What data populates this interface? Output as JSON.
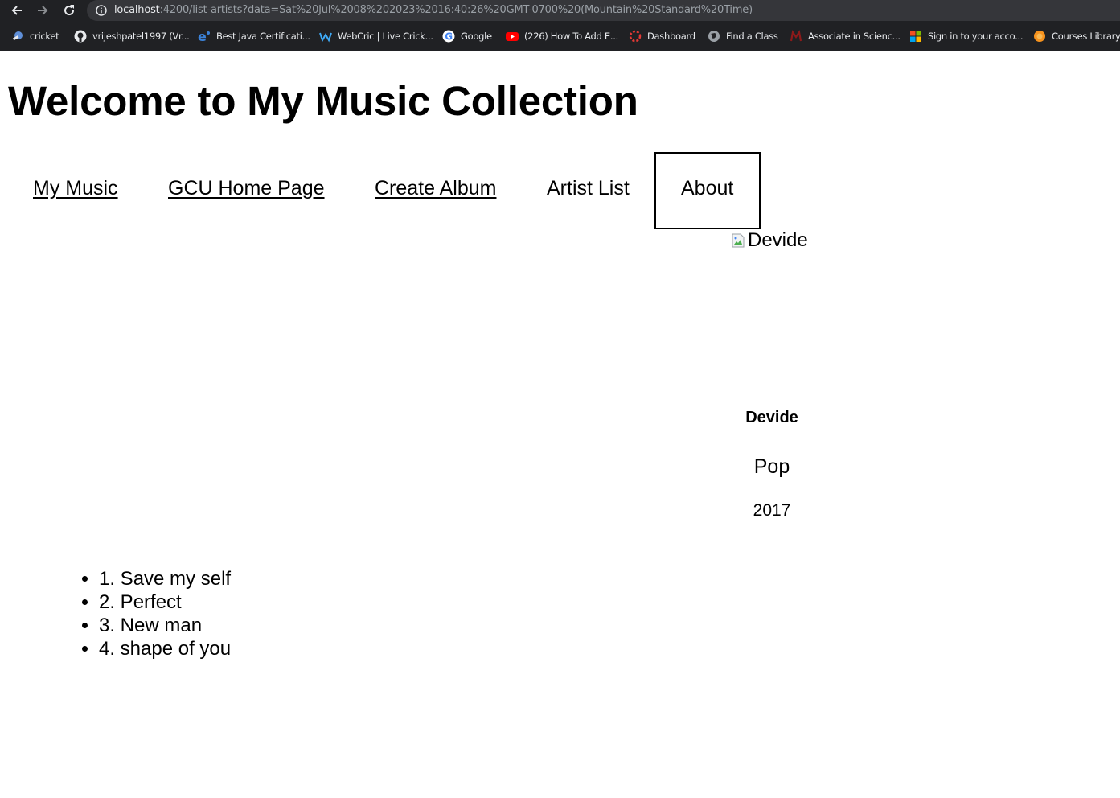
{
  "browser": {
    "url_host": "localhost",
    "url_path": ":4200/list-artists?data=Sat%20Jul%2008%202023%2016:40:26%20GMT-0700%20(Mountain%20Standard%20Time)",
    "bookmarks": [
      {
        "label": "cricket",
        "icon": "cricket-icon"
      },
      {
        "label": "vrijeshpatel1997 (Vr...",
        "icon": "github-icon"
      },
      {
        "label": "Best Java Certificati...",
        "icon": "java-e-icon"
      },
      {
        "label": "WebCric | Live Crick...",
        "icon": "webcric-icon"
      },
      {
        "label": "Google",
        "icon": "google-icon"
      },
      {
        "label": "(226) How To Add E...",
        "icon": "youtube-icon"
      },
      {
        "label": "Dashboard",
        "icon": "dashboard-icon"
      },
      {
        "label": "Find a Class",
        "icon": "globe-icon"
      },
      {
        "label": "Associate in Scienc...",
        "icon": "college-icon"
      },
      {
        "label": "Sign in to your acco...",
        "icon": "microsoft-icon"
      },
      {
        "label": "Courses Library",
        "icon": "courses-icon"
      }
    ]
  },
  "page": {
    "title": "Welcome to My Music Collection",
    "nav": {
      "my_music": "My Music",
      "gcu_home": "GCU Home Page",
      "create_album": "Create Album",
      "artist_list": "Artist List",
      "about": "About"
    },
    "album": {
      "image_alt": "Devide",
      "title": "Devide",
      "genre": "Pop",
      "year": "2017",
      "tracks": [
        "1. Save my self",
        "2. Perfect",
        "3. New man",
        "4. shape of you"
      ]
    }
  },
  "colors": {
    "chrome_bg": "#202124",
    "omnibox_bg": "#35363a",
    "chrome_text": "#e8eaed",
    "url_path_text": "#9aa0a6"
  }
}
